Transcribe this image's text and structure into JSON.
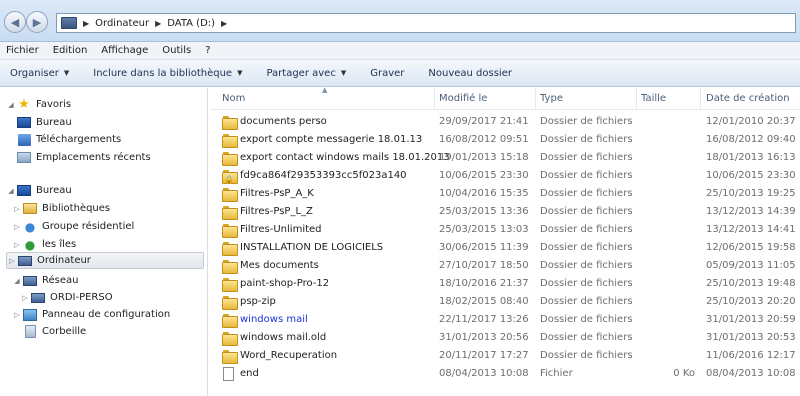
{
  "address": {
    "crumbs": [
      "Ordinateur",
      "DATA (D:)"
    ]
  },
  "menu": [
    "Fichier",
    "Edition",
    "Affichage",
    "Outils",
    "?"
  ],
  "commands": [
    {
      "label": "Organiser",
      "dropdown": true
    },
    {
      "label": "Inclure dans la bibliothèque",
      "dropdown": true
    },
    {
      "label": "Partager avec",
      "dropdown": true
    },
    {
      "label": "Graver",
      "dropdown": false
    },
    {
      "label": "Nouveau dossier",
      "dropdown": false
    }
  ],
  "nav": {
    "favoris": "Favoris",
    "bureau_fav": "Bureau",
    "telechargements": "Téléchargements",
    "emplacements": "Emplacements récents",
    "bureau": "Bureau",
    "bibliotheques": "Bibliothèques",
    "groupe": "Groupe résidentiel",
    "iles": "les îles",
    "ordinateur": "Ordinateur",
    "reseau": "Réseau",
    "ordi_perso": "ORDI-PERSO",
    "panneau": "Panneau de configuration",
    "corbeille": "Corbeille"
  },
  "columns": {
    "name": "Nom",
    "modified": "Modifié le",
    "type": "Type",
    "size": "Taille",
    "created": "Date de création"
  },
  "files": [
    {
      "name": "documents perso",
      "modified": "29/09/2017 21:41",
      "type": "Dossier de fichiers",
      "size": "",
      "created": "12/01/2010 20:37",
      "kind": "folder"
    },
    {
      "name": "export compte messagerie 18.01.13",
      "modified": "16/08/2012 09:51",
      "type": "Dossier de fichiers",
      "size": "",
      "created": "16/08/2012 09:40",
      "kind": "folder"
    },
    {
      "name": "export contact windows mails 18.01.2013",
      "modified": "19/01/2013 15:18",
      "type": "Dossier de fichiers",
      "size": "",
      "created": "18/01/2013 16:13",
      "kind": "folder"
    },
    {
      "name": "fd9ca864f29353393cc5f023a140",
      "modified": "10/06/2015 23:30",
      "type": "Dossier de fichiers",
      "size": "",
      "created": "10/06/2015 23:30",
      "kind": "locked"
    },
    {
      "name": "Filtres-PsP_A_K",
      "modified": "10/04/2016 15:35",
      "type": "Dossier de fichiers",
      "size": "",
      "created": "25/10/2013 19:25",
      "kind": "folder"
    },
    {
      "name": "Filtres-PsP_L_Z",
      "modified": "25/03/2015 13:36",
      "type": "Dossier de fichiers",
      "size": "",
      "created": "13/12/2013 14:39",
      "kind": "folder"
    },
    {
      "name": "Filtres-Unlimited",
      "modified": "25/03/2015 13:03",
      "type": "Dossier de fichiers",
      "size": "",
      "created": "13/12/2013 14:41",
      "kind": "folder"
    },
    {
      "name": "INSTALLATION DE LOGICIELS",
      "modified": "30/06/2015 11:39",
      "type": "Dossier de fichiers",
      "size": "",
      "created": "12/06/2015 19:58",
      "kind": "folder"
    },
    {
      "name": "Mes documents",
      "modified": "27/10/2017 18:50",
      "type": "Dossier de fichiers",
      "size": "",
      "created": "05/09/2013 11:05",
      "kind": "folder"
    },
    {
      "name": "paint-shop-Pro-12",
      "modified": "18/10/2016 21:37",
      "type": "Dossier de fichiers",
      "size": "",
      "created": "25/10/2013 19:48",
      "kind": "folder"
    },
    {
      "name": "psp-zip",
      "modified": "18/02/2015 08:40",
      "type": "Dossier de fichiers",
      "size": "",
      "created": "25/10/2013 20:20",
      "kind": "folder"
    },
    {
      "name": "windows mail",
      "modified": "22/11/2017 13:26",
      "type": "Dossier de fichiers",
      "size": "",
      "created": "31/01/2013 20:59",
      "kind": "folder",
      "link": true
    },
    {
      "name": "windows mail.old",
      "modified": "31/01/2013 20:56",
      "type": "Dossier de fichiers",
      "size": "",
      "created": "31/01/2013 20:53",
      "kind": "folder"
    },
    {
      "name": "Word_Recuperation",
      "modified": "20/11/2017 17:27",
      "type": "Dossier de fichiers",
      "size": "",
      "created": "11/06/2016 12:17",
      "kind": "folder"
    },
    {
      "name": "end",
      "modified": "08/04/2013 10:08",
      "type": "Fichier",
      "size": "0 Ko",
      "created": "08/04/2013 10:08",
      "kind": "file"
    }
  ]
}
